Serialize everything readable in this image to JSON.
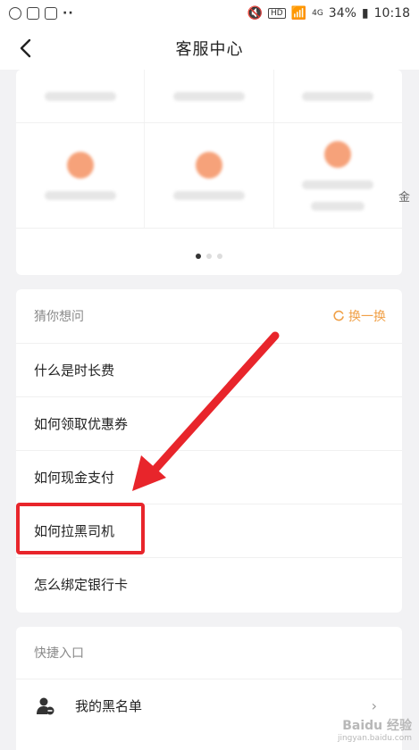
{
  "status_bar": {
    "battery": "34%",
    "time": "10:18",
    "network": "4G",
    "hd": "HD"
  },
  "header": {
    "title": "客服中心",
    "back_icon": "chevron-left-icon"
  },
  "top_grid": {
    "partial_text": "金",
    "pager": {
      "total": 3,
      "active": 0
    }
  },
  "guess": {
    "title": "猜你想问",
    "refresh_label": "换一换",
    "accent_color": "#f0a047",
    "questions": [
      "什么是时长费",
      "如何领取优惠券",
      "如何现金支付",
      "如何拉黑司机",
      "怎么绑定银行卡"
    ]
  },
  "shortcuts": {
    "title": "快捷入口",
    "items": [
      {
        "label": "我的黑名单",
        "icon": "user-blocked-icon",
        "chevron": "›"
      }
    ]
  },
  "annotation": {
    "color": "#e8252b",
    "highlighted_question": "如何拉黑司机"
  },
  "watermark": {
    "text": "Baidu 经验",
    "url": "jingyan.baidu.com"
  }
}
